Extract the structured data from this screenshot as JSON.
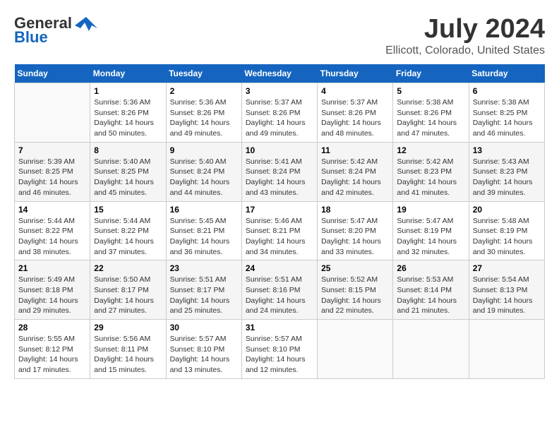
{
  "header": {
    "logo_general": "General",
    "logo_blue": "Blue",
    "month_year": "July 2024",
    "location": "Ellicott, Colorado, United States"
  },
  "days_of_week": [
    "Sunday",
    "Monday",
    "Tuesday",
    "Wednesday",
    "Thursday",
    "Friday",
    "Saturday"
  ],
  "weeks": [
    [
      {
        "day": "",
        "info": ""
      },
      {
        "day": "1",
        "info": "Sunrise: 5:36 AM\nSunset: 8:26 PM\nDaylight: 14 hours\nand 50 minutes."
      },
      {
        "day": "2",
        "info": "Sunrise: 5:36 AM\nSunset: 8:26 PM\nDaylight: 14 hours\nand 49 minutes."
      },
      {
        "day": "3",
        "info": "Sunrise: 5:37 AM\nSunset: 8:26 PM\nDaylight: 14 hours\nand 49 minutes."
      },
      {
        "day": "4",
        "info": "Sunrise: 5:37 AM\nSunset: 8:26 PM\nDaylight: 14 hours\nand 48 minutes."
      },
      {
        "day": "5",
        "info": "Sunrise: 5:38 AM\nSunset: 8:26 PM\nDaylight: 14 hours\nand 47 minutes."
      },
      {
        "day": "6",
        "info": "Sunrise: 5:38 AM\nSunset: 8:25 PM\nDaylight: 14 hours\nand 46 minutes."
      }
    ],
    [
      {
        "day": "7",
        "info": "Sunrise: 5:39 AM\nSunset: 8:25 PM\nDaylight: 14 hours\nand 46 minutes."
      },
      {
        "day": "8",
        "info": "Sunrise: 5:40 AM\nSunset: 8:25 PM\nDaylight: 14 hours\nand 45 minutes."
      },
      {
        "day": "9",
        "info": "Sunrise: 5:40 AM\nSunset: 8:24 PM\nDaylight: 14 hours\nand 44 minutes."
      },
      {
        "day": "10",
        "info": "Sunrise: 5:41 AM\nSunset: 8:24 PM\nDaylight: 14 hours\nand 43 minutes."
      },
      {
        "day": "11",
        "info": "Sunrise: 5:42 AM\nSunset: 8:24 PM\nDaylight: 14 hours\nand 42 minutes."
      },
      {
        "day": "12",
        "info": "Sunrise: 5:42 AM\nSunset: 8:23 PM\nDaylight: 14 hours\nand 41 minutes."
      },
      {
        "day": "13",
        "info": "Sunrise: 5:43 AM\nSunset: 8:23 PM\nDaylight: 14 hours\nand 39 minutes."
      }
    ],
    [
      {
        "day": "14",
        "info": "Sunrise: 5:44 AM\nSunset: 8:22 PM\nDaylight: 14 hours\nand 38 minutes."
      },
      {
        "day": "15",
        "info": "Sunrise: 5:44 AM\nSunset: 8:22 PM\nDaylight: 14 hours\nand 37 minutes."
      },
      {
        "day": "16",
        "info": "Sunrise: 5:45 AM\nSunset: 8:21 PM\nDaylight: 14 hours\nand 36 minutes."
      },
      {
        "day": "17",
        "info": "Sunrise: 5:46 AM\nSunset: 8:21 PM\nDaylight: 14 hours\nand 34 minutes."
      },
      {
        "day": "18",
        "info": "Sunrise: 5:47 AM\nSunset: 8:20 PM\nDaylight: 14 hours\nand 33 minutes."
      },
      {
        "day": "19",
        "info": "Sunrise: 5:47 AM\nSunset: 8:19 PM\nDaylight: 14 hours\nand 32 minutes."
      },
      {
        "day": "20",
        "info": "Sunrise: 5:48 AM\nSunset: 8:19 PM\nDaylight: 14 hours\nand 30 minutes."
      }
    ],
    [
      {
        "day": "21",
        "info": "Sunrise: 5:49 AM\nSunset: 8:18 PM\nDaylight: 14 hours\nand 29 minutes."
      },
      {
        "day": "22",
        "info": "Sunrise: 5:50 AM\nSunset: 8:17 PM\nDaylight: 14 hours\nand 27 minutes."
      },
      {
        "day": "23",
        "info": "Sunrise: 5:51 AM\nSunset: 8:17 PM\nDaylight: 14 hours\nand 25 minutes."
      },
      {
        "day": "24",
        "info": "Sunrise: 5:51 AM\nSunset: 8:16 PM\nDaylight: 14 hours\nand 24 minutes."
      },
      {
        "day": "25",
        "info": "Sunrise: 5:52 AM\nSunset: 8:15 PM\nDaylight: 14 hours\nand 22 minutes."
      },
      {
        "day": "26",
        "info": "Sunrise: 5:53 AM\nSunset: 8:14 PM\nDaylight: 14 hours\nand 21 minutes."
      },
      {
        "day": "27",
        "info": "Sunrise: 5:54 AM\nSunset: 8:13 PM\nDaylight: 14 hours\nand 19 minutes."
      }
    ],
    [
      {
        "day": "28",
        "info": "Sunrise: 5:55 AM\nSunset: 8:12 PM\nDaylight: 14 hours\nand 17 minutes."
      },
      {
        "day": "29",
        "info": "Sunrise: 5:56 AM\nSunset: 8:11 PM\nDaylight: 14 hours\nand 15 minutes."
      },
      {
        "day": "30",
        "info": "Sunrise: 5:57 AM\nSunset: 8:10 PM\nDaylight: 14 hours\nand 13 minutes."
      },
      {
        "day": "31",
        "info": "Sunrise: 5:57 AM\nSunset: 8:10 PM\nDaylight: 14 hours\nand 12 minutes."
      },
      {
        "day": "",
        "info": ""
      },
      {
        "day": "",
        "info": ""
      },
      {
        "day": "",
        "info": ""
      }
    ]
  ]
}
